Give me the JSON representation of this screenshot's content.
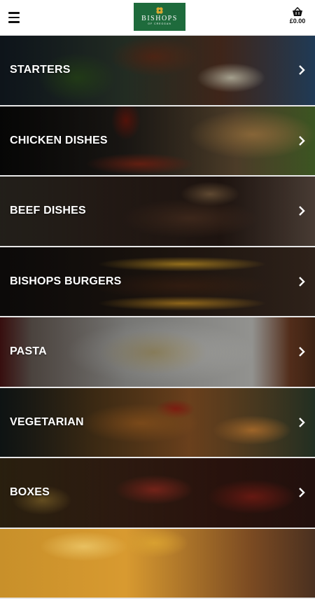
{
  "header": {
    "menu_icon": "hamburger-menu-icon",
    "logo": {
      "name": "BISHOPS",
      "subtitle": "OF CREGGAN",
      "color": "#1e6b3c"
    },
    "cart": {
      "icon": "basket-icon",
      "total": "£0.00"
    }
  },
  "categories": [
    {
      "label": "STARTERS"
    },
    {
      "label": "CHICKEN DISHES"
    },
    {
      "label": "BEEF DISHES"
    },
    {
      "label": "BISHOPS BURGERS"
    },
    {
      "label": "PASTA"
    },
    {
      "label": "VEGETARIAN"
    },
    {
      "label": "BOXES"
    },
    {
      "label": ""
    }
  ]
}
